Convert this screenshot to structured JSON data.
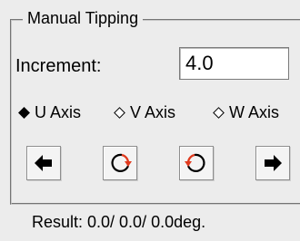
{
  "panel": {
    "title": "Manual Tipping",
    "increment_label": "Increment:",
    "increment_value": "4.0",
    "axes": [
      {
        "label": "U Axis",
        "selected": true
      },
      {
        "label": "V Axis",
        "selected": false
      },
      {
        "label": "W Axis",
        "selected": false
      }
    ],
    "buttons": [
      {
        "icon": "arrow-left-icon"
      },
      {
        "icon": "rotate-clockwise-icon"
      },
      {
        "icon": "rotate-counterclockwise-icon"
      },
      {
        "icon": "arrow-right-icon"
      }
    ],
    "result_text": "Result:  0.0/  0.0/  0.0deg."
  },
  "colors": {
    "background": "#ececec",
    "rotate_arrow_accent": "#e03a1e"
  }
}
